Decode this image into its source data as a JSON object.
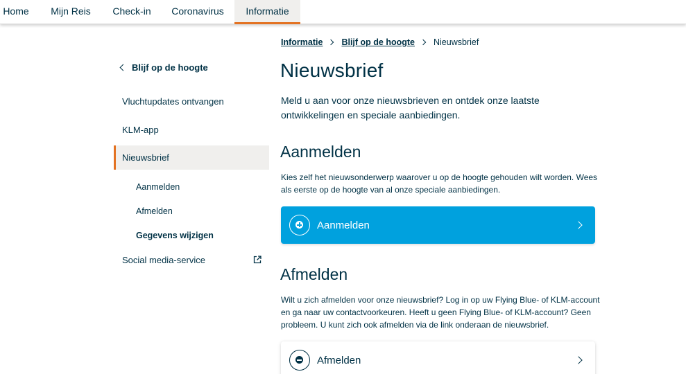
{
  "topnav": {
    "tabs": [
      {
        "label": "Home",
        "active": false
      },
      {
        "label": "Mijn Reis",
        "active": false
      },
      {
        "label": "Check-in",
        "active": false
      },
      {
        "label": "Coronavirus",
        "active": false
      },
      {
        "label": "Informatie",
        "active": true
      }
    ]
  },
  "sidebar": {
    "back_label": "Blijf op de hoogte",
    "items": [
      {
        "label": "Vluchtupdates ontvangen"
      },
      {
        "label": "KLM-app"
      },
      {
        "label": "Nieuwsbrief",
        "active": true
      },
      {
        "label": "Social media-service",
        "external": true
      }
    ],
    "subitems": [
      {
        "label": "Aanmelden"
      },
      {
        "label": "Afmelden"
      },
      {
        "label": "Gegevens wijzigen",
        "bold": true
      }
    ]
  },
  "breadcrumb": {
    "items": [
      "Informatie",
      "Blijf op de hoogte"
    ],
    "current": "Nieuwsbrief"
  },
  "main": {
    "title": "Nieuwsbrief",
    "intro": "Meld u aan voor onze nieuwsbrieven en ontdek onze laatste ontwikkelingen en speciale aanbiedingen.",
    "subscribe": {
      "heading": "Aanmelden",
      "text": "Kies zelf het nieuwsonderwerp waarover u op de hoogte gehouden wilt worden. Wees als eerste op de hoogte van al onze speciale aanbiedingen.",
      "button_label": "Aanmelden"
    },
    "unsubscribe": {
      "heading": "Afmelden",
      "text": "Wilt u zich afmelden voor onze nieuwsbrief? Log in op uw Flying Blue- of KLM-account en ga naar uw contactvoorkeuren. Heeft u geen Flying Blue- of KLM-account? Geen probleem. U kunt zich ook afmelden via de link onderaan de nieuwsbrief.",
      "button_label": "Afmelden"
    }
  },
  "colors": {
    "primary_text": "#003145",
    "accent": "#e37222",
    "button_blue": "#00a1de",
    "active_bg": "#f0efed"
  }
}
